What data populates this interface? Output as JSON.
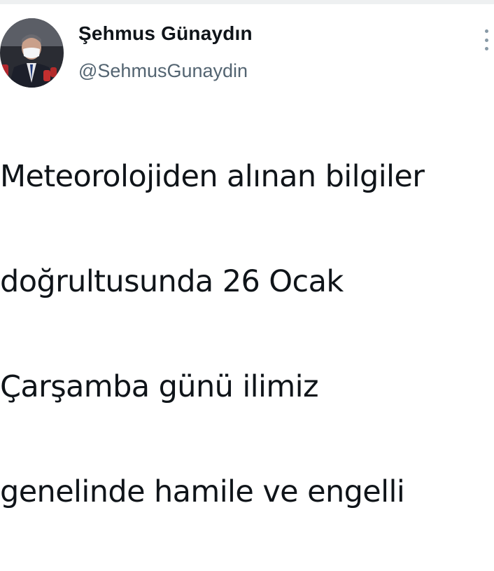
{
  "tweet": {
    "author": {
      "display_name": "Şehmus Günaydın",
      "handle": "@SehmusGunaydin",
      "avatar_icon": "profile-photo"
    },
    "more_icon": "more-options-icon",
    "text_lines": [
      "Meteorolojiden alınan bilgiler",
      "doğrultusunda 26 Ocak",
      "Çarşamba günü ilimiz",
      "genelinde hamile ve engelli"
    ]
  }
}
